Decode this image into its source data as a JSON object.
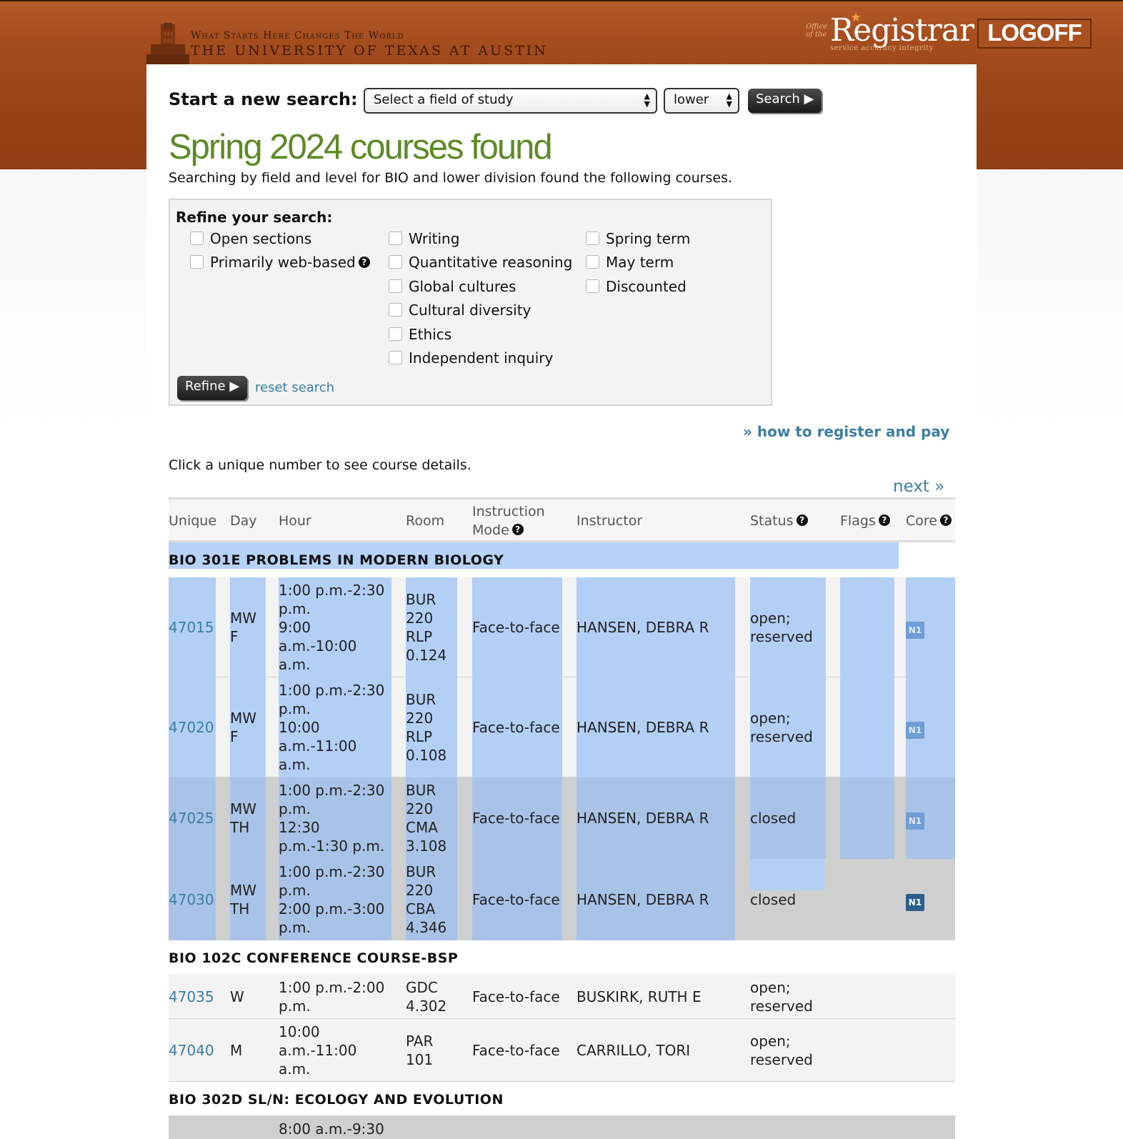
{
  "header": {
    "tagline": "What Starts Here Changes The World",
    "university": "THE UNIVERSITY OF TEXAS AT AUSTIN",
    "registrar_office": "Office of the",
    "registrar_word": "Registrar",
    "registrar_sub": "service   accuracy  integrity",
    "logoff_label": "LOGOFF"
  },
  "search": {
    "label": "Start a new search:",
    "field_value": "Select a field of study",
    "level_value": "lower",
    "button_label": "Search ▶"
  },
  "heading": "Spring 2024 courses found",
  "summary": "Searching by field and level for BIO and lower division found the following courses.",
  "refine": {
    "title": "Refine your search:",
    "options_col1": [
      "Open sections",
      "Primarily web-based"
    ],
    "options_col2": [
      "Writing",
      "Quantitative reasoning",
      "Global cultures",
      "Cultural diversity",
      "Ethics",
      "Independent inquiry"
    ],
    "options_col3": [
      "Spring term",
      "May term",
      "Discounted"
    ],
    "button_label": "Refine ▶",
    "reset_label": "reset search"
  },
  "howto_label": "» how to register and pay",
  "click_note": "Click a unique number to see course details.",
  "next_label": "next »",
  "table": {
    "headers": {
      "unique": "Unique",
      "day": "Day",
      "hour": "Hour",
      "room": "Room",
      "mode_line1": "Instruction",
      "mode_line2": "Mode",
      "instructor": "Instructor",
      "status": "Status",
      "flags": "Flags",
      "core": "Core"
    },
    "courses": [
      {
        "title": "BIO 301E PROBLEMS IN MODERN BIOLOGY",
        "sections": [
          {
            "unique": "47015",
            "day": "MW\nF",
            "hour": "1:00 p.m.-2:30\np.m.\n9:00\na.m.-10:00\na.m.",
            "room": "BUR\n220\nRLP\n0.124",
            "mode": "Face-to-face",
            "instructor": "HANSEN, DEBRA R",
            "status": "open;\nreserved",
            "core": "N1"
          },
          {
            "unique": "47020",
            "day": "MW\nF",
            "hour": "1:00 p.m.-2:30\np.m.\n10:00\na.m.-11:00\na.m.",
            "room": "BUR\n220\nRLP\n0.108",
            "mode": "Face-to-face",
            "instructor": "HANSEN, DEBRA R",
            "status": "open;\nreserved",
            "core": "N1"
          },
          {
            "unique": "47025",
            "day": "MW\nTH",
            "hour": "1:00 p.m.-2:30\np.m.\n12:30\np.m.-1:30 p.m.",
            "room": "BUR\n220\nCMA\n3.108",
            "mode": "Face-to-face",
            "instructor": "HANSEN, DEBRA R",
            "status": "closed",
            "core": "N1"
          },
          {
            "unique": "47030",
            "day": "MW\nTH",
            "hour": "1:00 p.m.-2:30\np.m.\n2:00 p.m.-3:00\np.m.",
            "room": "BUR\n220\nCBA\n4.346",
            "mode": "Face-to-face",
            "instructor": "HANSEN, DEBRA R",
            "status": "closed",
            "core": "N1"
          }
        ]
      },
      {
        "title": "BIO 102C CONFERENCE COURSE-BSP",
        "sections": [
          {
            "unique": "47035",
            "day": "W",
            "hour": "1:00 p.m.-2:00\np.m.",
            "room": "GDC\n4.302",
            "mode": "Face-to-face",
            "instructor": "BUSKIRK, RUTH E",
            "status": "open;\nreserved",
            "core": ""
          },
          {
            "unique": "47040",
            "day": "M",
            "hour": "10:00\na.m.-11:00\na.m.",
            "room": "PAR\n101",
            "mode": "Face-to-face",
            "instructor": "CARRILLO, TORI",
            "status": "open;\nreserved",
            "core": ""
          }
        ]
      },
      {
        "title": "BIO 302D SL/N: ECOLOGY AND EVOLUTION",
        "sections": [
          {
            "unique": "",
            "day": "",
            "hour": "8:00 a.m.-9:30",
            "room": "",
            "mode": "",
            "instructor": "",
            "status": "",
            "core": ""
          }
        ]
      }
    ]
  }
}
